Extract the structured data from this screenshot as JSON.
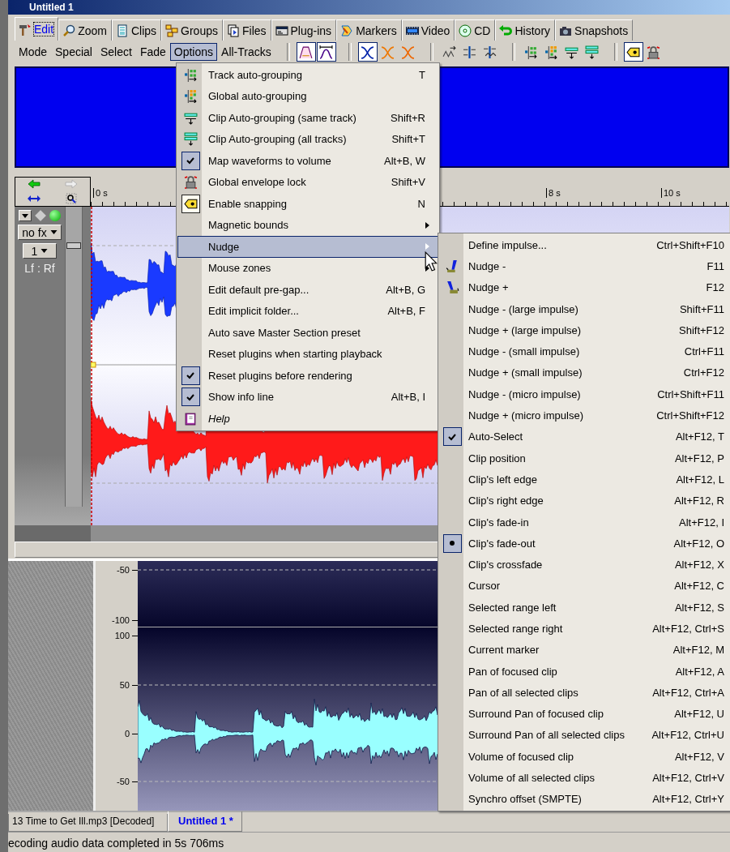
{
  "window": {
    "title": "Untitled 1"
  },
  "tabs": [
    {
      "label": "Edit",
      "selected": true
    },
    {
      "label": "Zoom",
      "selected": false
    },
    {
      "label": "Clips",
      "selected": false
    },
    {
      "label": "Groups",
      "selected": false
    },
    {
      "label": "Files",
      "selected": false
    },
    {
      "label": "Plug-ins",
      "selected": false
    },
    {
      "label": "Markers",
      "selected": false
    },
    {
      "label": "Video",
      "selected": false
    },
    {
      "label": "CD",
      "selected": false
    },
    {
      "label": "History",
      "selected": false
    },
    {
      "label": "Snapshots",
      "selected": false
    }
  ],
  "toolbar": {
    "menus": [
      {
        "label": "Mode",
        "selected": false
      },
      {
        "label": "Special",
        "selected": false
      },
      {
        "label": "Select",
        "selected": false
      },
      {
        "label": "Fade",
        "selected": false
      },
      {
        "label": "Options",
        "selected": true
      },
      {
        "label": "All-Tracks",
        "selected": false
      }
    ],
    "buttons": [
      {
        "pressed": true
      },
      {
        "pressed": true
      },
      {
        "pressed": true
      },
      {
        "pressed": false
      },
      {
        "pressed": false
      },
      {
        "pressed": false
      },
      {
        "pressed": false
      },
      {
        "pressed": false
      },
      {
        "pressed": false
      },
      {
        "pressed": false
      },
      {
        "pressed": false
      },
      {
        "pressed": false
      },
      {
        "pressed": true
      },
      {
        "pressed": false
      }
    ]
  },
  "timeline": {
    "labels": [
      "0 s",
      "8 s",
      "10 s"
    ]
  },
  "track": {
    "fx": "no fx",
    "channel": "1",
    "routing": "Lf : Rf",
    "active": true,
    "level": 0.88
  },
  "lower_track": {
    "scale_labels": [
      "-50",
      "-100",
      "100",
      "50",
      "0",
      "-50"
    ]
  },
  "documents": [
    {
      "label": "13 Time to Get Ill.mp3 [Decoded]",
      "selected": false
    },
    {
      "label": "Untitled 1 *",
      "selected": true
    }
  ],
  "status_bar": "ecoding audio data completed in 5s 706ms",
  "options_menu": {
    "groups": [
      [
        {
          "label": "Track auto-grouping",
          "shortcut": "T",
          "kind": "command",
          "checked": false,
          "highlighted": false
        },
        {
          "label": "Global auto-grouping",
          "kind": "command",
          "checked": false,
          "highlighted": false
        },
        {
          "label": "Clip Auto-grouping (same track)",
          "shortcut": "Shift+R",
          "kind": "command",
          "checked": false,
          "highlighted": false
        },
        {
          "label": "Clip Auto-grouping (all tracks)",
          "shortcut": "Shift+T",
          "kind": "command",
          "checked": false,
          "highlighted": false
        }
      ],
      [
        {
          "label": "Map waveforms to volume",
          "shortcut": "Alt+B, W",
          "kind": "command",
          "checked": true,
          "highlighted": false
        },
        {
          "label": "Global envelope lock",
          "shortcut": "Shift+V",
          "kind": "command",
          "checked": false,
          "highlighted": false
        },
        {
          "label": "Enable snapping",
          "shortcut": "N",
          "kind": "command",
          "checked": true,
          "highlighted": false
        },
        {
          "label": "Magnetic bounds",
          "kind": "submenu",
          "checked": false,
          "highlighted": false
        },
        {
          "label": "Nudge",
          "kind": "submenu",
          "checked": false,
          "highlighted": true
        }
      ],
      [
        {
          "label": "Mouse zones",
          "kind": "submenu",
          "checked": false,
          "highlighted": false
        },
        {
          "label": "Edit default pre-gap...",
          "shortcut": "Alt+B, G",
          "kind": "command",
          "checked": false,
          "highlighted": false
        },
        {
          "label": "Edit implicit folder...",
          "shortcut": "Alt+B, F",
          "kind": "command",
          "checked": false,
          "highlighted": false
        }
      ],
      [
        {
          "label": "Auto save Master Section preset",
          "kind": "command",
          "checked": false,
          "highlighted": false
        },
        {
          "label": "Reset plugins when starting playback",
          "kind": "command",
          "checked": false,
          "highlighted": false
        },
        {
          "label": "Reset plugins before rendering",
          "kind": "command",
          "checked": true,
          "highlighted": false
        },
        {
          "label": "Show info line",
          "shortcut": "Alt+B, I",
          "kind": "command",
          "checked": true,
          "highlighted": false
        }
      ],
      [
        {
          "label": "Help",
          "kind": "help",
          "checked": false,
          "highlighted": false
        }
      ]
    ]
  },
  "nudge_submenu": {
    "groups": [
      [
        {
          "label": "Define impulse...",
          "shortcut": "Ctrl+Shift+F10",
          "kind": "command",
          "checked": false,
          "highlighted": false
        }
      ],
      [
        {
          "label": "Nudge -",
          "shortcut": "F11",
          "kind": "command",
          "checked": false,
          "highlighted": false
        },
        {
          "label": "Nudge +",
          "shortcut": "F12",
          "kind": "command",
          "checked": false,
          "highlighted": false
        },
        {
          "label": "Nudge - (large impulse)",
          "shortcut": "Shift+F11",
          "kind": "command",
          "checked": false,
          "highlighted": false
        },
        {
          "label": "Nudge + (large impulse)",
          "shortcut": "Shift+F12",
          "kind": "command",
          "checked": false,
          "highlighted": false
        },
        {
          "label": "Nudge - (small impulse)",
          "shortcut": "Ctrl+F11",
          "kind": "command",
          "checked": false,
          "highlighted": false
        },
        {
          "label": "Nudge + (small impulse)",
          "shortcut": "Ctrl+F12",
          "kind": "command",
          "checked": false,
          "highlighted": false
        },
        {
          "label": "Nudge - (micro impulse)",
          "shortcut": "Ctrl+Shift+F11",
          "kind": "command",
          "checked": false,
          "highlighted": false
        },
        {
          "label": "Nudge + (micro impulse)",
          "shortcut": "Ctrl+Shift+F12",
          "kind": "command",
          "checked": false,
          "highlighted": false
        }
      ],
      [
        {
          "label": "Auto-Select",
          "shortcut": "Alt+F12, T",
          "kind": "command",
          "checked": true,
          "highlighted": false
        }
      ],
      [
        {
          "label": "Clip position",
          "shortcut": "Alt+F12, P",
          "kind": "radio",
          "checked": false,
          "highlighted": false
        },
        {
          "label": "Clip's left edge",
          "shortcut": "Alt+F12, L",
          "kind": "radio",
          "checked": false,
          "highlighted": false
        },
        {
          "label": "Clip's right edge",
          "shortcut": "Alt+F12, R",
          "kind": "radio",
          "checked": false,
          "highlighted": false
        },
        {
          "label": "Clip's fade-in",
          "shortcut": "Alt+F12, I",
          "kind": "radio",
          "checked": false,
          "highlighted": false
        },
        {
          "label": "Clip's fade-out",
          "shortcut": "Alt+F12, O",
          "kind": "radio",
          "checked": true,
          "highlighted": false
        },
        {
          "label": "Clip's crossfade",
          "shortcut": "Alt+F12, X",
          "kind": "radio",
          "checked": false,
          "highlighted": false
        },
        {
          "label": "Cursor",
          "shortcut": "Alt+F12, C",
          "kind": "radio",
          "checked": false,
          "highlighted": false
        },
        {
          "label": "Selected range left",
          "shortcut": "Alt+F12, S",
          "kind": "radio",
          "checked": false,
          "highlighted": false
        },
        {
          "label": "Selected range right",
          "shortcut": "Alt+F12, Ctrl+S",
          "kind": "radio",
          "checked": false,
          "highlighted": false
        },
        {
          "label": "Current marker",
          "shortcut": "Alt+F12, M",
          "kind": "radio",
          "checked": false,
          "highlighted": false
        }
      ],
      [
        {
          "label": "Pan of focused clip",
          "shortcut": "Alt+F12, A",
          "kind": "command",
          "checked": false,
          "highlighted": false
        },
        {
          "label": "Pan of all selected clips",
          "shortcut": "Alt+F12, Ctrl+A",
          "kind": "command",
          "checked": false,
          "highlighted": false
        },
        {
          "label": "Surround Pan of focused clip",
          "shortcut": "Alt+F12, U",
          "kind": "command",
          "checked": false,
          "highlighted": false
        },
        {
          "label": "Surround Pan of all selected clips",
          "shortcut": "Alt+F12, Ctrl+U",
          "kind": "command",
          "checked": false,
          "highlighted": false
        },
        {
          "label": "Volume of focused clip",
          "shortcut": "Alt+F12, V",
          "kind": "command",
          "checked": false,
          "highlighted": false
        },
        {
          "label": "Volume of all selected clips",
          "shortcut": "Alt+F12, Ctrl+V",
          "kind": "command",
          "checked": false,
          "highlighted": false
        }
      ],
      [
        {
          "label": "Synchro offset (SMPTE)",
          "shortcut": "Alt+F12, Ctrl+Y",
          "kind": "command",
          "checked": false,
          "highlighted": false
        }
      ]
    ]
  }
}
